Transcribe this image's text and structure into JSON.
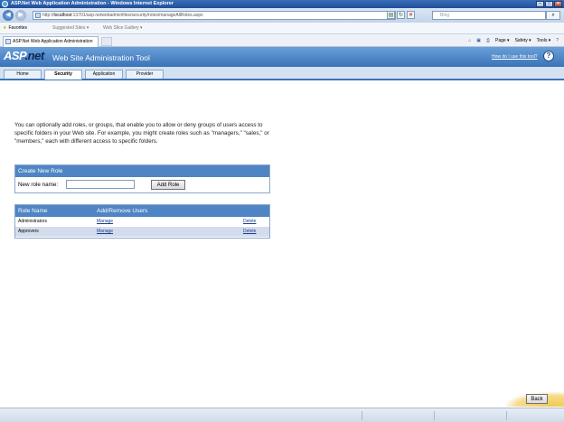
{
  "window": {
    "title": "ASP.Net Web Application Administration - Windows Internet Explorer"
  },
  "browser": {
    "address_prefix": "http://",
    "address_host": "localhost",
    "address_rest": ":13701/asp.netwebadminfiles/security/roles/manageAllRoles.aspx",
    "search_placeholder": "Bing",
    "favorites_label": "Favorites",
    "suggested_sites_label": "Suggested Sites ▾",
    "web_slice_gallery_label": "Web Slice Gallery ▾",
    "tab_title": "ASP.Net Web Application Administration",
    "commands": {
      "page": "Page ▾",
      "safety": "Safety ▾",
      "tools": "Tools ▾"
    }
  },
  "header": {
    "logo_asp": "ASP",
    "logo_net": ".net",
    "tool_name": "Web Site Administration Tool",
    "help_link": "How do I use this tool?"
  },
  "tabs": [
    {
      "label": "Home"
    },
    {
      "label": "Security"
    },
    {
      "label": "Application"
    },
    {
      "label": "Provider"
    }
  ],
  "intro_text": "You can optionally add roles, or groups, that enable you to allow or deny groups of users access to specific folders in your Web site. For example, you might create roles such as \"managers,\" \"sales,\" or \"members,\" each with different access to specific folders.",
  "create_role": {
    "heading": "Create New Role",
    "label": "New role name:",
    "input_value": "",
    "button": "Add Role"
  },
  "roles_table": {
    "columns": [
      "Role Name",
      "Add/Remove Users"
    ],
    "rows": [
      {
        "name": "Administrators",
        "manage": "Manage",
        "delete": "Delete"
      },
      {
        "name": "Approvers",
        "manage": "Manage",
        "delete": "Delete"
      }
    ]
  },
  "back_button": "Back"
}
